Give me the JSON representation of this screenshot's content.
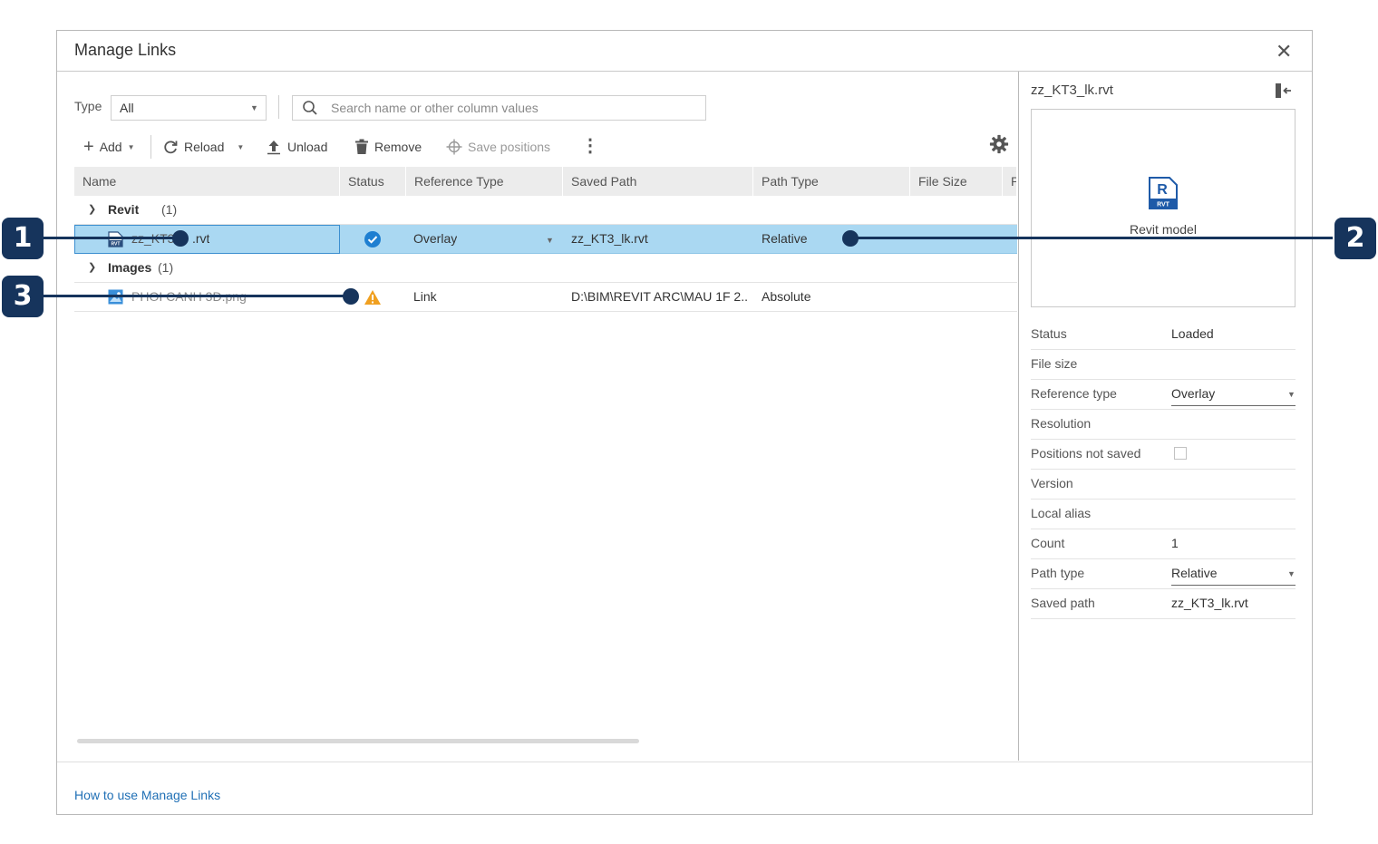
{
  "dialog": {
    "title": "Manage Links",
    "close_icon": "close-icon",
    "help_link": "How to use Manage Links"
  },
  "filter": {
    "type_label": "Type",
    "type_value": "All",
    "search_placeholder": "Search name or other column values"
  },
  "toolbar": {
    "add": "Add",
    "reload": "Reload",
    "unload": "Unload",
    "remove": "Remove",
    "save_positions": "Save positions"
  },
  "columns": [
    "Name",
    "Status",
    "Reference Type",
    "Saved Path",
    "Path Type",
    "File Size",
    "P"
  ],
  "groups": [
    {
      "name": "Revit",
      "count": "(1)",
      "rows": [
        {
          "name_prefix": "zz_KT3",
          "name_suffix": ".rvt",
          "status": "loaded",
          "reference_type": "Overlay",
          "saved_path": "zz_KT3_lk.rvt",
          "path_type": "Relative"
        }
      ]
    },
    {
      "name": "Images",
      "count": "(1)",
      "rows": [
        {
          "name": "PHOI CANH 3D.png",
          "status": "warning",
          "reference_type": "Link",
          "saved_path": "D:\\BIM\\REVIT ARC\\MAU 1F 2...",
          "path_type": "Absolute"
        }
      ]
    }
  ],
  "details": {
    "file_name": "zz_KT3_lk.rvt",
    "preview_label": "Revit model",
    "props": {
      "status_label": "Status",
      "status_value": "Loaded",
      "file_size_label": "File size",
      "reference_type_label": "Reference type",
      "reference_type_value": "Overlay",
      "resolution_label": "Resolution",
      "positions_label": "Positions not saved",
      "version_label": "Version",
      "local_alias_label": "Local alias",
      "count_label": "Count",
      "count_value": "1",
      "path_type_label": "Path type",
      "path_type_value": "Relative",
      "saved_path_label": "Saved path",
      "saved_path_value": "zz_KT3_lk.rvt"
    }
  },
  "callouts": [
    "1",
    "2",
    "3"
  ],
  "colors": {
    "selection": "#aad8f2",
    "accent_blue": "#1f6fb5",
    "callout": "#16345c",
    "warning": "#f0a020"
  }
}
